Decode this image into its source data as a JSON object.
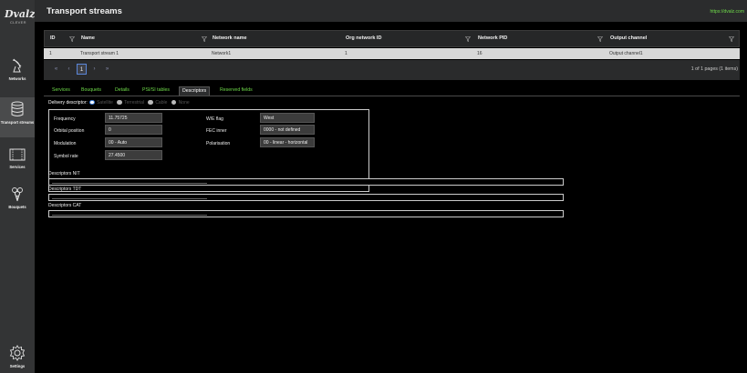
{
  "app": {
    "logo_main": "Dvalz",
    "logo_sub": "CLEVER",
    "page_title": "Transport streams",
    "header_link": "https://dvalz.com"
  },
  "sidebar": {
    "items": [
      {
        "label": "Networks",
        "icon": "satellite-dish-icon"
      },
      {
        "label": "Transport streams",
        "icon": "database-icon"
      },
      {
        "label": "Services",
        "icon": "film-icon"
      },
      {
        "label": "Bouquets",
        "icon": "flower-icon"
      },
      {
        "label": "Settings",
        "icon": "gear-icon"
      }
    ]
  },
  "grid": {
    "columns": [
      "ID",
      "Name",
      "Network name",
      "Org network ID",
      "Network PID",
      "Output channel"
    ],
    "rows": [
      {
        "id": "1",
        "name": "Transport stream 1",
        "network_name": "Network1",
        "org_network_id": "1",
        "network_pid": "16",
        "output_channel": "Output channel1"
      }
    ]
  },
  "pager": {
    "first": "«",
    "prev": "‹",
    "current": "1",
    "next": "›",
    "last": "»",
    "info": "1 of 1 pages (1 items)"
  },
  "tabs": [
    "Services",
    "Bouquets",
    "Details",
    "PSI/SI tables",
    "Descriptors",
    "Reserved fields"
  ],
  "delivery": {
    "label": "Delivery descriptor:",
    "options": [
      "Satellite",
      "Terrestrial",
      "Cable",
      "None"
    ],
    "selected": 0
  },
  "form": {
    "frequency_label": "Frequency",
    "frequency": "11.75725",
    "orbital_label": "Orbital position",
    "orbital": "0",
    "modulation_label": "Modulation",
    "modulation": "00 - Auto",
    "symbol_label": "Symbol rate",
    "symbol": "27.4500",
    "we_label": "W/E flag",
    "we": "West",
    "fec_label": "FEC inner",
    "fec": "0000 - not defined",
    "pol_label": "Polarisation",
    "pol": "00 - linear - horizontal"
  },
  "descriptors": {
    "nit_label": "Descriptors NIT",
    "tdt_label": "Descriptors TDT",
    "cat_label": "Descriptors CAT"
  },
  "colors": {
    "accent_green": "#6fdc4a",
    "selected_row": "#d8d8d8",
    "sidebar": "#333435",
    "pager_highlight": "#5a86d8"
  }
}
